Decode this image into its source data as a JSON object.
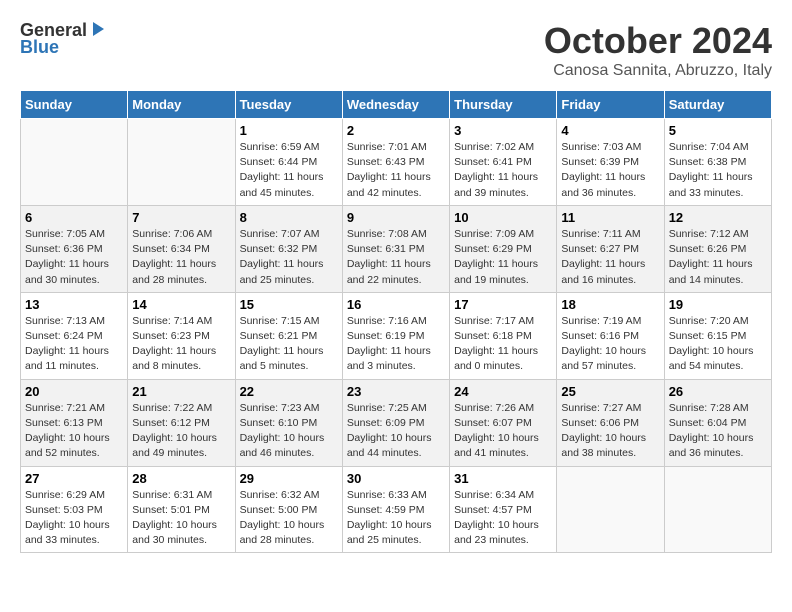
{
  "header": {
    "logo_general": "General",
    "logo_blue": "Blue",
    "title": "October 2024",
    "location": "Canosa Sannita, Abruzzo, Italy"
  },
  "weekdays": [
    "Sunday",
    "Monday",
    "Tuesday",
    "Wednesday",
    "Thursday",
    "Friday",
    "Saturday"
  ],
  "weeks": [
    [
      {
        "day": "",
        "info": ""
      },
      {
        "day": "",
        "info": ""
      },
      {
        "day": "1",
        "info": "Sunrise: 6:59 AM\nSunset: 6:44 PM\nDaylight: 11 hours\nand 45 minutes."
      },
      {
        "day": "2",
        "info": "Sunrise: 7:01 AM\nSunset: 6:43 PM\nDaylight: 11 hours\nand 42 minutes."
      },
      {
        "day": "3",
        "info": "Sunrise: 7:02 AM\nSunset: 6:41 PM\nDaylight: 11 hours\nand 39 minutes."
      },
      {
        "day": "4",
        "info": "Sunrise: 7:03 AM\nSunset: 6:39 PM\nDaylight: 11 hours\nand 36 minutes."
      },
      {
        "day": "5",
        "info": "Sunrise: 7:04 AM\nSunset: 6:38 PM\nDaylight: 11 hours\nand 33 minutes."
      }
    ],
    [
      {
        "day": "6",
        "info": "Sunrise: 7:05 AM\nSunset: 6:36 PM\nDaylight: 11 hours\nand 30 minutes."
      },
      {
        "day": "7",
        "info": "Sunrise: 7:06 AM\nSunset: 6:34 PM\nDaylight: 11 hours\nand 28 minutes."
      },
      {
        "day": "8",
        "info": "Sunrise: 7:07 AM\nSunset: 6:32 PM\nDaylight: 11 hours\nand 25 minutes."
      },
      {
        "day": "9",
        "info": "Sunrise: 7:08 AM\nSunset: 6:31 PM\nDaylight: 11 hours\nand 22 minutes."
      },
      {
        "day": "10",
        "info": "Sunrise: 7:09 AM\nSunset: 6:29 PM\nDaylight: 11 hours\nand 19 minutes."
      },
      {
        "day": "11",
        "info": "Sunrise: 7:11 AM\nSunset: 6:27 PM\nDaylight: 11 hours\nand 16 minutes."
      },
      {
        "day": "12",
        "info": "Sunrise: 7:12 AM\nSunset: 6:26 PM\nDaylight: 11 hours\nand 14 minutes."
      }
    ],
    [
      {
        "day": "13",
        "info": "Sunrise: 7:13 AM\nSunset: 6:24 PM\nDaylight: 11 hours\nand 11 minutes."
      },
      {
        "day": "14",
        "info": "Sunrise: 7:14 AM\nSunset: 6:23 PM\nDaylight: 11 hours\nand 8 minutes."
      },
      {
        "day": "15",
        "info": "Sunrise: 7:15 AM\nSunset: 6:21 PM\nDaylight: 11 hours\nand 5 minutes."
      },
      {
        "day": "16",
        "info": "Sunrise: 7:16 AM\nSunset: 6:19 PM\nDaylight: 11 hours\nand 3 minutes."
      },
      {
        "day": "17",
        "info": "Sunrise: 7:17 AM\nSunset: 6:18 PM\nDaylight: 11 hours\nand 0 minutes."
      },
      {
        "day": "18",
        "info": "Sunrise: 7:19 AM\nSunset: 6:16 PM\nDaylight: 10 hours\nand 57 minutes."
      },
      {
        "day": "19",
        "info": "Sunrise: 7:20 AM\nSunset: 6:15 PM\nDaylight: 10 hours\nand 54 minutes."
      }
    ],
    [
      {
        "day": "20",
        "info": "Sunrise: 7:21 AM\nSunset: 6:13 PM\nDaylight: 10 hours\nand 52 minutes."
      },
      {
        "day": "21",
        "info": "Sunrise: 7:22 AM\nSunset: 6:12 PM\nDaylight: 10 hours\nand 49 minutes."
      },
      {
        "day": "22",
        "info": "Sunrise: 7:23 AM\nSunset: 6:10 PM\nDaylight: 10 hours\nand 46 minutes."
      },
      {
        "day": "23",
        "info": "Sunrise: 7:25 AM\nSunset: 6:09 PM\nDaylight: 10 hours\nand 44 minutes."
      },
      {
        "day": "24",
        "info": "Sunrise: 7:26 AM\nSunset: 6:07 PM\nDaylight: 10 hours\nand 41 minutes."
      },
      {
        "day": "25",
        "info": "Sunrise: 7:27 AM\nSunset: 6:06 PM\nDaylight: 10 hours\nand 38 minutes."
      },
      {
        "day": "26",
        "info": "Sunrise: 7:28 AM\nSunset: 6:04 PM\nDaylight: 10 hours\nand 36 minutes."
      }
    ],
    [
      {
        "day": "27",
        "info": "Sunrise: 6:29 AM\nSunset: 5:03 PM\nDaylight: 10 hours\nand 33 minutes."
      },
      {
        "day": "28",
        "info": "Sunrise: 6:31 AM\nSunset: 5:01 PM\nDaylight: 10 hours\nand 30 minutes."
      },
      {
        "day": "29",
        "info": "Sunrise: 6:32 AM\nSunset: 5:00 PM\nDaylight: 10 hours\nand 28 minutes."
      },
      {
        "day": "30",
        "info": "Sunrise: 6:33 AM\nSunset: 4:59 PM\nDaylight: 10 hours\nand 25 minutes."
      },
      {
        "day": "31",
        "info": "Sunrise: 6:34 AM\nSunset: 4:57 PM\nDaylight: 10 hours\nand 23 minutes."
      },
      {
        "day": "",
        "info": ""
      },
      {
        "day": "",
        "info": ""
      }
    ]
  ]
}
